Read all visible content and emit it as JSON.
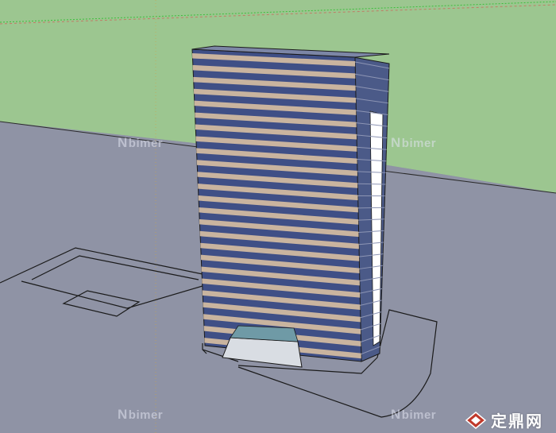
{
  "scene": {
    "sky_color": "#9cc690",
    "ground_color": "#8f93a5",
    "facade_color": "#3f4f86",
    "band_color": "#c9b49f",
    "edge_color": "#1a1a1a",
    "axis_green": "#3cbf3c",
    "axis_red": "#d84b4b"
  },
  "watermarks": [
    {
      "label": "bimer"
    },
    {
      "label": "bimer"
    },
    {
      "label": "bimer"
    },
    {
      "label": "bimer"
    }
  ],
  "brand": {
    "text": "定鼎网",
    "logo_icon": "diamond-logo-icon",
    "logo_color": "#c0392b"
  }
}
